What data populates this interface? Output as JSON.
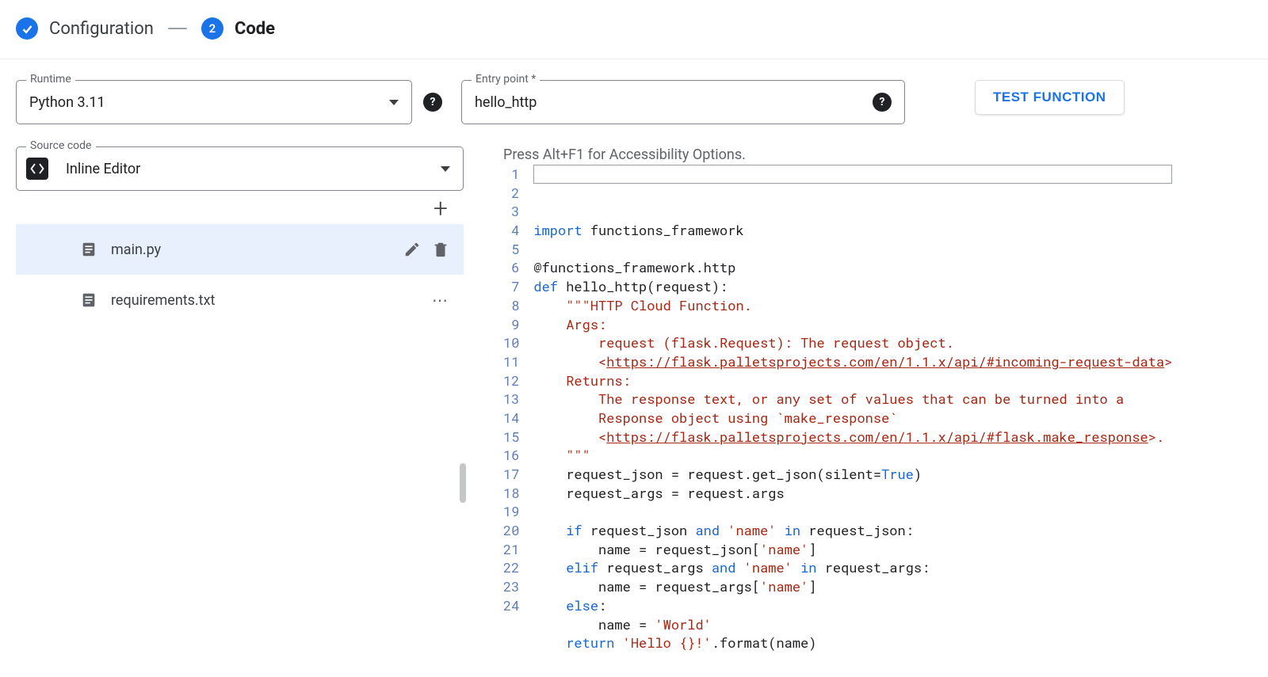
{
  "stepper": {
    "step1_label": "Configuration",
    "step2_number": "2",
    "step2_label": "Code"
  },
  "controls": {
    "runtime_label": "Runtime",
    "runtime_value": "Python 3.11",
    "entry_label": "Entry point *",
    "entry_value": "hello_http",
    "test_button": "TEST FUNCTION",
    "source_label": "Source code",
    "source_value": "Inline Editor"
  },
  "files": [
    {
      "name": "main.py",
      "selected": true
    },
    {
      "name": "requirements.txt",
      "selected": false
    }
  ],
  "editor": {
    "a11y_hint": "Press Alt+F1 for Accessibility Options.",
    "lines": [
      {
        "n": 1,
        "segs": [
          [
            "kw",
            "import"
          ],
          [
            "",
            " functions_framework"
          ]
        ]
      },
      {
        "n": 2,
        "segs": []
      },
      {
        "n": 3,
        "segs": [
          [
            "dec",
            "@functions_framework.http"
          ]
        ]
      },
      {
        "n": 4,
        "segs": [
          [
            "kw",
            "def"
          ],
          [
            "",
            " hello_http(request):"
          ]
        ]
      },
      {
        "n": 5,
        "segs": [
          [
            "",
            "    "
          ],
          [
            "str",
            "\"\"\"HTTP Cloud Function."
          ]
        ]
      },
      {
        "n": 6,
        "segs": [
          [
            "",
            "    "
          ],
          [
            "str",
            "Args:"
          ]
        ]
      },
      {
        "n": 7,
        "segs": [
          [
            "",
            "        "
          ],
          [
            "str",
            "request (flask.Request): The request object."
          ]
        ]
      },
      {
        "n": 8,
        "segs": [
          [
            "",
            "        "
          ],
          [
            "str",
            "<"
          ],
          [
            "str link",
            "https://flask.palletsprojects.com/en/1.1.x/api/#incoming-request-data"
          ],
          [
            "str",
            ">"
          ]
        ]
      },
      {
        "n": 9,
        "segs": [
          [
            "",
            "    "
          ],
          [
            "str",
            "Returns:"
          ]
        ]
      },
      {
        "n": 10,
        "segs": [
          [
            "",
            "        "
          ],
          [
            "str",
            "The response text, or any set of values that can be turned into a"
          ]
        ]
      },
      {
        "n": 11,
        "segs": [
          [
            "",
            "        "
          ],
          [
            "str",
            "Response object using `make_response`"
          ]
        ]
      },
      {
        "n": 12,
        "segs": [
          [
            "",
            "        "
          ],
          [
            "str",
            "<"
          ],
          [
            "str link",
            "https://flask.palletsprojects.com/en/1.1.x/api/#flask.make_response"
          ],
          [
            "str",
            ">."
          ]
        ]
      },
      {
        "n": 13,
        "segs": [
          [
            "",
            "    "
          ],
          [
            "str",
            "\"\"\""
          ]
        ]
      },
      {
        "n": 14,
        "segs": [
          [
            "",
            "    request_json = request.get_json(silent="
          ],
          [
            "true-kw",
            "True"
          ],
          [
            "",
            ")"
          ]
        ]
      },
      {
        "n": 15,
        "segs": [
          [
            "",
            "    request_args = request.args"
          ]
        ]
      },
      {
        "n": 16,
        "segs": []
      },
      {
        "n": 17,
        "segs": [
          [
            "",
            "    "
          ],
          [
            "kw",
            "if"
          ],
          [
            "",
            " request_json "
          ],
          [
            "kw",
            "and"
          ],
          [
            "",
            " "
          ],
          [
            "str",
            "'name'"
          ],
          [
            "",
            " "
          ],
          [
            "kw",
            "in"
          ],
          [
            "",
            " request_json:"
          ]
        ]
      },
      {
        "n": 18,
        "segs": [
          [
            "",
            "        name = request_json["
          ],
          [
            "str",
            "'name'"
          ],
          [
            "",
            "]"
          ]
        ]
      },
      {
        "n": 19,
        "segs": [
          [
            "",
            "    "
          ],
          [
            "kw",
            "elif"
          ],
          [
            "",
            " request_args "
          ],
          [
            "kw",
            "and"
          ],
          [
            "",
            " "
          ],
          [
            "str",
            "'name'"
          ],
          [
            "",
            " "
          ],
          [
            "kw",
            "in"
          ],
          [
            "",
            " request_args:"
          ]
        ]
      },
      {
        "n": 20,
        "segs": [
          [
            "",
            "        name = request_args["
          ],
          [
            "str",
            "'name'"
          ],
          [
            "",
            "]"
          ]
        ]
      },
      {
        "n": 21,
        "segs": [
          [
            "",
            "    "
          ],
          [
            "kw",
            "else"
          ],
          [
            "",
            ":"
          ]
        ]
      },
      {
        "n": 22,
        "segs": [
          [
            "",
            "        name = "
          ],
          [
            "str",
            "'World'"
          ]
        ]
      },
      {
        "n": 23,
        "segs": [
          [
            "",
            "    "
          ],
          [
            "kw",
            "return"
          ],
          [
            "",
            " "
          ],
          [
            "str",
            "'Hello {}!'"
          ],
          [
            "",
            ".format(name)"
          ]
        ]
      },
      {
        "n": 24,
        "segs": []
      }
    ]
  }
}
